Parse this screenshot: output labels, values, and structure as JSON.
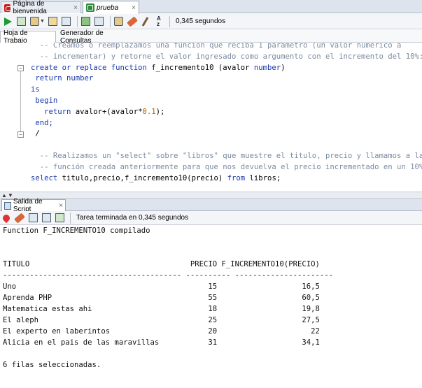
{
  "tabs": [
    {
      "label": "Página de bienvenida",
      "icon": "oracle-logo-icon",
      "close": "×"
    },
    {
      "label": "prueba",
      "icon": "sql-worksheet-icon",
      "close": "×"
    }
  ],
  "toolbar": {
    "elapsed": "0,345 segundos",
    "icons": [
      "run-statement-icon",
      "run-script-icon",
      "commit-icon",
      "dropdown-icon",
      "explain-plan-icon",
      "autotrace-icon",
      "rollback-icon",
      "sql-tuning-icon",
      "unshared-sql-icon",
      "clear-icon",
      "history-icon",
      "to-upper-icon"
    ]
  },
  "subtabs": {
    "worksheet": "Hoja de Trabajo",
    "query_builder": "Generador de Consultas"
  },
  "editor": {
    "lines": [
      {
        "parts": [
          {
            "t": "  -- Creamos o reemplazamos una función que reciba 1 parámetro (un valor numérico a",
            "c": "cm"
          }
        ]
      },
      {
        "parts": [
          {
            "t": "  -- incrementar) y retorne el valor ingresado como argumento con el incremento del 10%:",
            "c": "cm"
          }
        ]
      },
      {
        "parts": [
          {
            "t": "create or replace function",
            "c": "kw"
          },
          {
            "t": " f_incremento10 (avalor ",
            "c": ""
          },
          {
            "t": "number",
            "c": "kw"
          },
          {
            "t": ")",
            "c": ""
          }
        ]
      },
      {
        "parts": [
          {
            "t": " return number",
            "c": "kw"
          }
        ]
      },
      {
        "parts": [
          {
            "t": "is",
            "c": "kw"
          }
        ]
      },
      {
        "parts": [
          {
            "t": " begin",
            "c": "kw"
          }
        ]
      },
      {
        "parts": [
          {
            "t": "   return",
            "c": "kw"
          },
          {
            "t": " avalor+(avalor*",
            "c": ""
          },
          {
            "t": "0.1",
            "c": "num"
          },
          {
            "t": ");",
            "c": ""
          }
        ]
      },
      {
        "parts": [
          {
            "t": " end;",
            "c": "kw"
          }
        ]
      },
      {
        "parts": [
          {
            "t": " /",
            "c": ""
          }
        ]
      },
      {
        "parts": [
          {
            "t": "",
            "c": ""
          }
        ]
      },
      {
        "parts": [
          {
            "t": "  -- Realizamos un \"select\" sobre \"libros\" que muestre el titulo, precio y llamamos a la",
            "c": "cm"
          }
        ]
      },
      {
        "parts": [
          {
            "t": "  -- función creada anteriormente para que nos devuelva el precio incrementado en un 10%:",
            "c": "cm"
          }
        ]
      },
      {
        "parts": [
          {
            "t": "select",
            "c": "kw"
          },
          {
            "t": " titulo,precio,f_incremento10(precio) ",
            "c": ""
          },
          {
            "t": "from",
            "c": "kw"
          },
          {
            "t": " libros;",
            "c": ""
          }
        ]
      }
    ]
  },
  "output_panel": {
    "tab_label": "Salida de Script",
    "tab_close": "×",
    "status": "Tarea terminada en 0,345 segundos",
    "icons": [
      "pin-icon",
      "clear-output-icon",
      "save-icon",
      "print-icon",
      "open-icon"
    ],
    "lines": [
      "Function F_INCREMENTO10 compilado",
      "",
      "",
      "TITULO                                    PRECIO F_INCREMENTO10(PRECIO)",
      "---------------------------------------- ---------- ----------------------",
      "Uno                                           15                   16,5",
      "Aprenda PHP                                   55                   60,5",
      "Matematica estas ahi                          18                   19,8",
      "El aleph                                      25                   27,5",
      "El experto en laberintos                      20                     22",
      "Alicia en el pais de las maravillas           31                   34,1",
      "",
      "6 filas seleccionadas."
    ]
  }
}
